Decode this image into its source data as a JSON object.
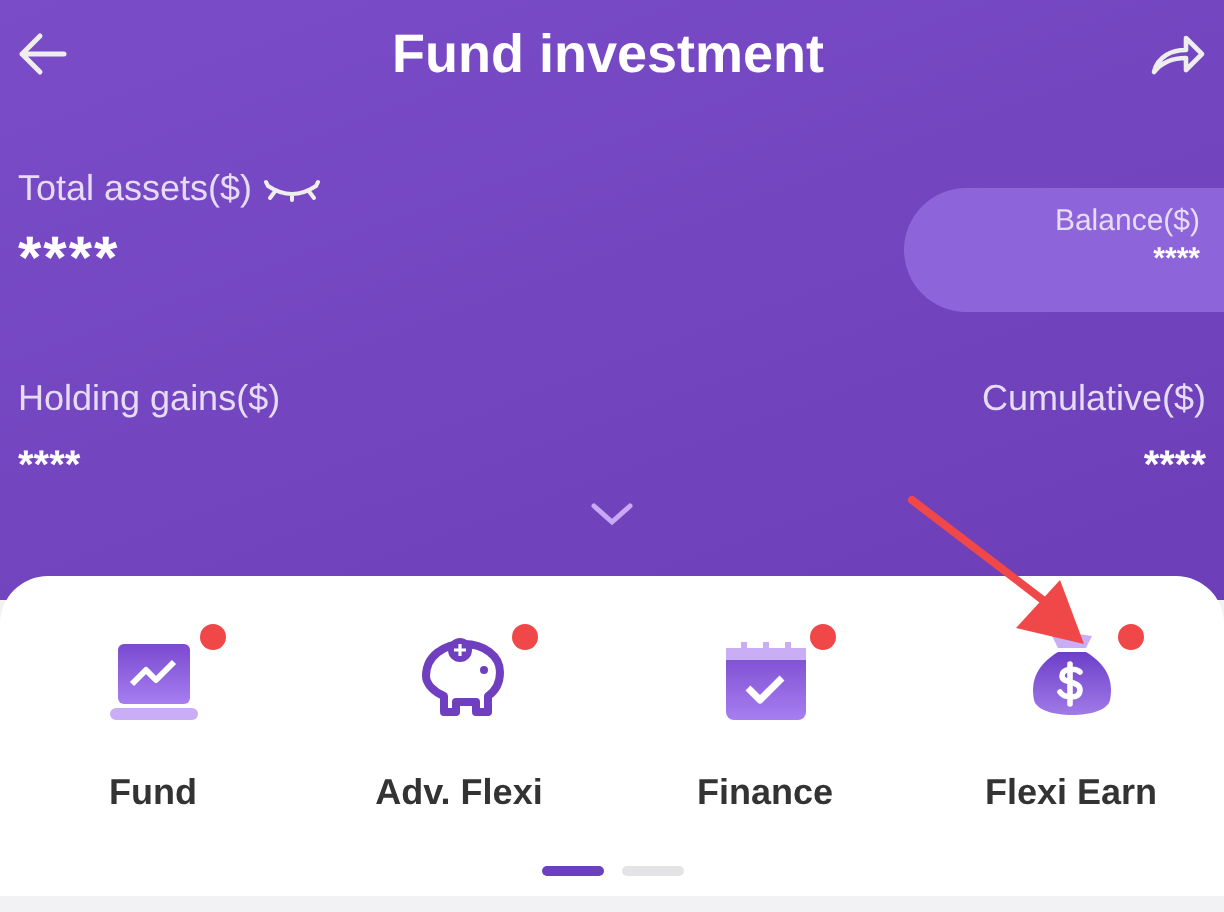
{
  "header": {
    "title": "Fund investment"
  },
  "summary": {
    "total_label": "Total assets($)",
    "total_value": "****",
    "balance_label": "Balance($)",
    "balance_value": "****",
    "gains_label": "Holding gains($)",
    "gains_value": "****",
    "cumulative_label": "Cumulative($)",
    "cumulative_value": "****"
  },
  "menu": [
    {
      "label": "Fund",
      "kind": "laptop",
      "badge": true
    },
    {
      "label": "Adv. Flexi",
      "kind": "piggy",
      "badge": true
    },
    {
      "label": "Finance",
      "kind": "calendar",
      "badge": true
    },
    {
      "label": "Flexi Earn",
      "kind": "moneybag",
      "badge": true
    }
  ],
  "pages": [
    {
      "selected": true
    },
    {
      "selected": false
    }
  ]
}
